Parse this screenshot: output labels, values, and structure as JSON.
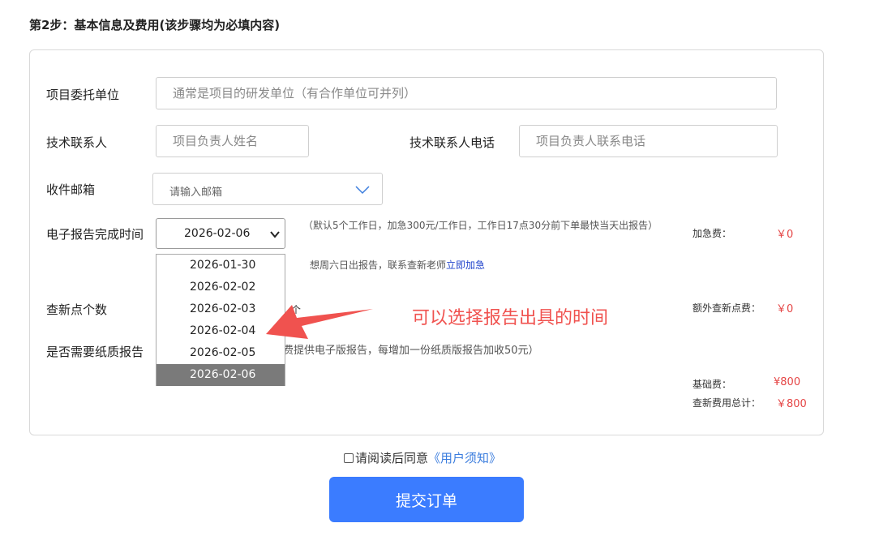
{
  "step_title": "第2步：基本信息及费用(该步骤均为必填内容)",
  "form": {
    "client_label": "项目委托单位",
    "client_placeholder": "通常是项目的研发单位（有合作单位可并列）",
    "contact_label": "技术联系人",
    "contact_placeholder": "项目负责人姓名",
    "phone_label": "技术联系人电话",
    "phone_placeholder": "项目负责人联系电话",
    "email_label": "收件邮箱",
    "email_placeholder": "请输入邮箱",
    "report_time_label": "电子报告完成时间",
    "report_time_value": "2026-02-06",
    "report_time_options": [
      "2026-01-30",
      "2026-02-02",
      "2026-02-03",
      "2026-02-04",
      "2026-02-05",
      "2026-02-06"
    ],
    "report_time_note": "（默认5个工作日，加急300元/工作日，工作日17点30分前下单最快当天出报告）",
    "weekend_note": "想周六日出报告，联系查新老师",
    "weekend_link": "立即加急",
    "points_label": "查新点个数",
    "points_unit": "个",
    "paper_label": "是否需要纸质报告",
    "paper_note": "费提供电子版报告，每增加一份纸质版报告加收50元）"
  },
  "fees": {
    "urgent_label": "加急费：",
    "urgent_value": "￥0",
    "extra_points_label": "额外查新点费：",
    "extra_points_value": "￥0",
    "base_label": "基础费：",
    "base_value": "¥800",
    "total_label": "查新费用总计：",
    "total_value": "￥800"
  },
  "annotation": "可以选择报告出具的时间",
  "agree": {
    "text": "请阅读后同意",
    "link": "《用户须知》"
  },
  "submit_label": "提交订单",
  "colors": {
    "primary": "#3b7cff",
    "fee_red": "#e54545",
    "annotation_red": "#f0524f",
    "link_blue": "#3b7dde"
  }
}
